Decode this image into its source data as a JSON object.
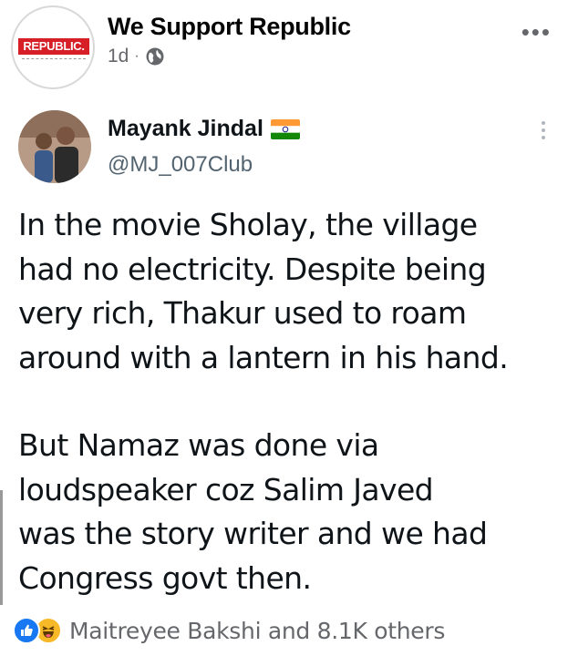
{
  "post": {
    "page_name": "We Support Republic",
    "time": "1d",
    "separator": "·",
    "privacy_icon": "globe-icon",
    "more_icon": "more-horizontal-icon",
    "avatar_logo_text": "REPUBLIC."
  },
  "tweet": {
    "user_name": "Mayank Jindal",
    "flag_icon": "india-flag-icon",
    "handle": "@MJ_007Club",
    "paragraphs": [
      "In the movie Sholay, the village\nhad no electricity. Despite being\nvery rich, Thakur used to roam\naround with a lantern in his hand.",
      "But Namaz was done via\nloudspeaker coz Salim Javed\nwas the story writer and we had\nCongress govt then."
    ]
  },
  "reactions": {
    "icons": [
      "like-icon",
      "haha-icon"
    ],
    "text": "Maitreyee Bakshi and 8.1K others"
  },
  "colors": {
    "fb_blue": "#1877f2",
    "haha_yellow": "#f7b928",
    "republic_red": "#d61f26",
    "secondary_text": "#65676b"
  }
}
